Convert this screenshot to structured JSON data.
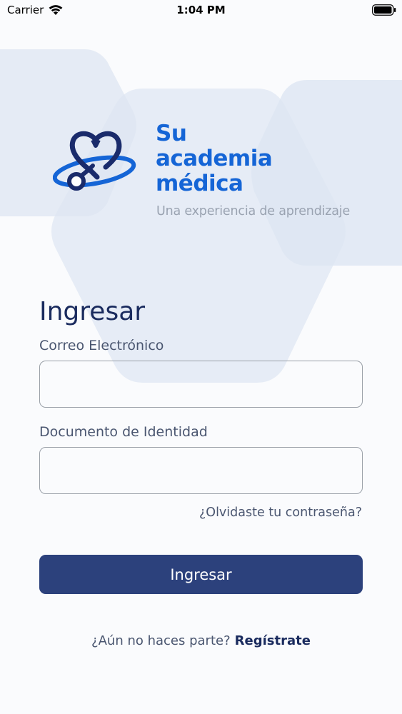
{
  "status_bar": {
    "carrier": "Carrier",
    "time": "1:04 PM",
    "icons": [
      "wifi-icon",
      "battery-icon"
    ]
  },
  "brand": {
    "logo_icon": "stethoscope-heart-logo",
    "line1": "Su",
    "line2": "academia",
    "line3": "médica",
    "tagline": "Una experiencia de aprendizaje",
    "colors": {
      "logo_dark": "#1a2b6b",
      "logo_blue": "#1565d6",
      "tagline": "#9aa3b1"
    }
  },
  "login": {
    "title": "Ingresar",
    "email_label": "Correo Electrónico",
    "email_value": "",
    "email_placeholder": "",
    "document_label": "Documento de Identidad",
    "document_value": "",
    "document_placeholder": "",
    "forgot_password": "¿Olvidaste tu contraseña?",
    "submit_label": "Ingresar",
    "signup_prompt": "¿Aún no haces parte?",
    "signup_link": "Regístrate"
  },
  "colors": {
    "background": "#fafbfd",
    "primary_button": "#2c417c",
    "text_dark": "#1a2b5e",
    "text_muted": "#4a5670",
    "decor_shape": "#dfe7f2"
  }
}
